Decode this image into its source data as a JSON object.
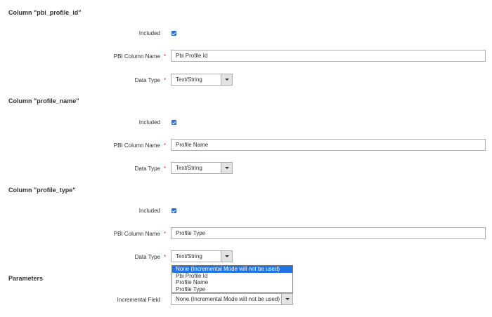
{
  "columns": [
    {
      "title": "Column \"pbi_profile_id\"",
      "included_label": "Included",
      "name_label": "PBI Column Name",
      "name_value": "Pbi Profile Id",
      "type_label": "Data Type",
      "type_value": "Text/String"
    },
    {
      "title": "Column \"profile_name\"",
      "included_label": "Included",
      "name_label": "PBI Column Name",
      "name_value": "Profile Name",
      "type_label": "Data Type",
      "type_value": "Text/String"
    },
    {
      "title": "Column \"profile_type\"",
      "included_label": "Included",
      "name_label": "PBI Column Name",
      "name_value": "Profile Type",
      "type_label": "Data Type",
      "type_value": "Text/String"
    }
  ],
  "required_marker": "*",
  "parameters": {
    "title": "Parameters",
    "incremental_label": "Incremental Field",
    "incremental_value": "None (Incremental Mode will not be used)",
    "options": [
      "None (Incremental Mode will not be used)",
      "Pbi Profile Id",
      "Profile Name",
      "Profile Type"
    ]
  },
  "colors": {
    "checkbox": "#2a6bd8",
    "selected_option": "#1e74e6",
    "required": "#e02b27"
  }
}
